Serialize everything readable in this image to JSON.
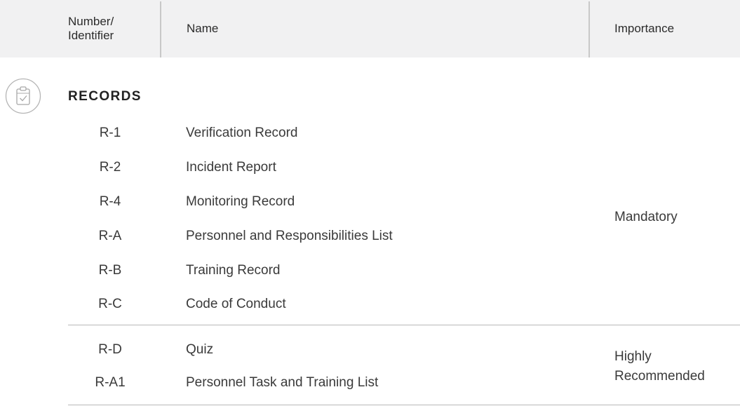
{
  "header": {
    "col_id": "Number/\nIdentifier",
    "col_name": "Name",
    "col_importance": "Importance"
  },
  "section": {
    "icon": "clipboard-check-icon",
    "title": "RECORDS"
  },
  "groups": [
    {
      "importance": "Mandatory",
      "rows": [
        {
          "id": "R-1",
          "name": "Verification Record"
        },
        {
          "id": "R-2",
          "name": "Incident Report"
        },
        {
          "id": "R-4",
          "name": "Monitoring Record"
        },
        {
          "id": "R-A",
          "name": "Personnel and Responsibilities List"
        },
        {
          "id": "R-B",
          "name": "Training Record"
        },
        {
          "id": "R-C",
          "name": "Code of Conduct"
        }
      ]
    },
    {
      "importance": "Highly\nRecommended",
      "rows": [
        {
          "id": "R-D",
          "name": "Quiz"
        },
        {
          "id": "R-A1",
          "name": "Personnel Task and Training List"
        }
      ]
    }
  ]
}
